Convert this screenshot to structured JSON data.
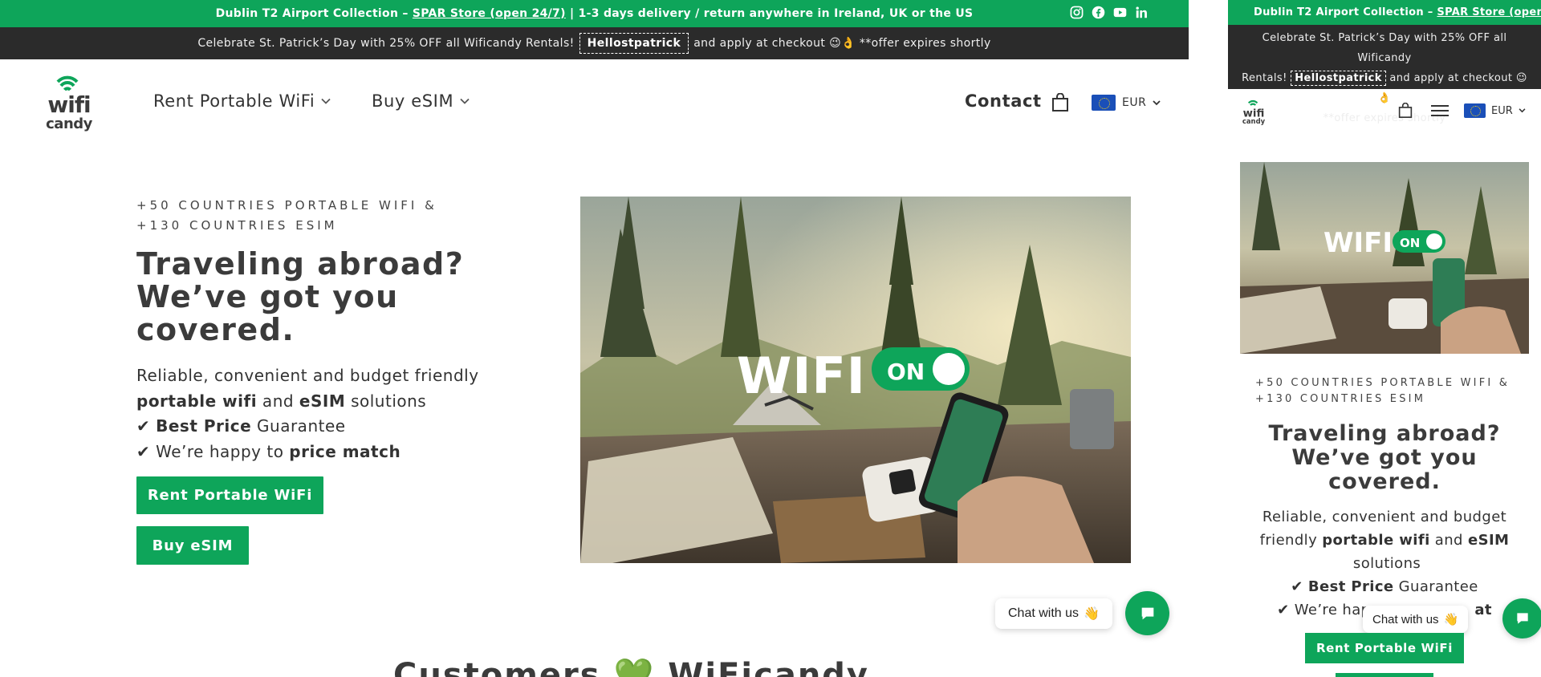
{
  "colors": {
    "brand_green": "#0ea55a",
    "promo_bg": "#2b2b2b",
    "text": "#3b3b3b"
  },
  "announcement": {
    "prefix": "Dublin T2 Airport Collection – ",
    "link": "SPAR Store (open 24/7)",
    "suffix": " | 1-3 days delivery / return anywhere in Ireland, UK or the US"
  },
  "socials": [
    "instagram-icon",
    "facebook-icon",
    "youtube-icon",
    "linkedin-icon"
  ],
  "promo": {
    "text_before": "Celebrate St. Patrick’s Day with 25% OFF all Wificandy Rentals!",
    "code": "Hellostpatrick",
    "text_after": "and apply at checkout 😉👌 **offer expires shortly"
  },
  "logo": {
    "line1": "wifi",
    "line2": "candy"
  },
  "nav": {
    "rent": "Rent Portable WiFi",
    "esim": "Buy eSIM",
    "contact": "Contact",
    "currency": "EUR"
  },
  "hero": {
    "eyebrow": "+50 COUNTRIES PORTABLE WIFI & +130 COUNTRIES ESIM",
    "title": "Traveling abroad? We’ve got you covered.",
    "body_line1": "Reliable, convenient and budget friendly",
    "portable_wifi": "portable wifi",
    "and": " and ",
    "esim": "eSIM",
    "solutions": " solutions",
    "check": "✔ ",
    "best_price": "Best Price",
    "guarantee": " Guarantee",
    "happy": "We’re happy to ",
    "price_match": "price match",
    "btn_rent": "Rent Portable WiFi",
    "btn_esim": "Buy eSIM",
    "image_wifi_text": "WIFI",
    "image_toggle_text": "ON"
  },
  "chat": {
    "label": "Chat with us",
    "emoji": "👋"
  },
  "section": {
    "title_before": "Customers ",
    "heart": "💚",
    "title_after": " WiFicandy"
  },
  "mobile": {
    "announcement_prefix": "Dublin T2 Airport Collection – ",
    "announcement_link": "SPAR Store (open",
    "promo_line1": "Celebrate St. Patrick’s Day with 25% OFF all Wificandy",
    "promo_rentals": "Rentals!",
    "promo_code": "Hellostpatrick",
    "promo_after": "and apply at checkout 😉👌",
    "promo_line3": "**offer expires shortly",
    "currency": "EUR",
    "eyebrow": "+50 COUNTRIES PORTABLE WIFI & +130 COUNTRIES ESIM",
    "title": "Traveling abroad? We’ve got you covered.",
    "body_pre": "Reliable, convenient and budget friendly ",
    "portable_wifi": "portable wifi",
    "and": " and ",
    "esim": "eSIM",
    "solutions": " solutions",
    "best_price": "Best Price",
    "guarantee": " Guarantee",
    "happy": "✔ We’re happ",
    "happy_tail": "at",
    "btn_rent": "Rent Portable WiFi",
    "chat_label": "Chat with us"
  }
}
